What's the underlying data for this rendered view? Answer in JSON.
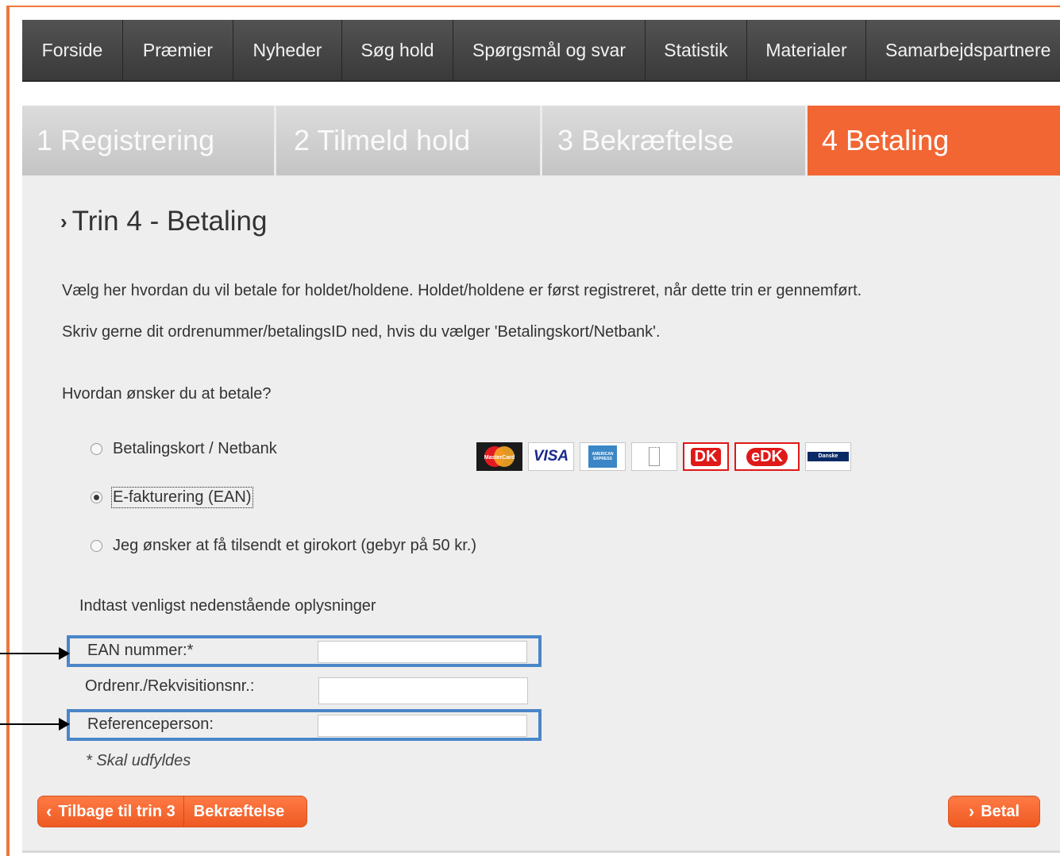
{
  "nav": {
    "items": [
      {
        "label": "Forside"
      },
      {
        "label": "Præmier"
      },
      {
        "label": "Nyheder"
      },
      {
        "label": "Søg hold"
      },
      {
        "label": "Spørgsmål og svar"
      },
      {
        "label": "Statistik"
      },
      {
        "label": "Materialer"
      },
      {
        "label": "Samarbejdspartnere"
      }
    ]
  },
  "steps": [
    {
      "label": "1 Registrering"
    },
    {
      "label": "2 Tilmeld hold"
    },
    {
      "label": "3 Bekræftelse"
    },
    {
      "label": "4 Betaling",
      "active": true
    }
  ],
  "page": {
    "title": "Trin 4 - Betaling",
    "intro1": "Vælg her hvordan du vil betale for holdet/holdene. Holdet/holdene er først registreret, når dette trin er gennemført.",
    "intro2": "Skriv gerne dit ordrenummer/betalingsID ned, hvis du vælger 'Betalingskort/Netbank'.",
    "question": "Hvordan ønsker du at betale?"
  },
  "payment_options": [
    {
      "label": "Betalingskort / Netbank",
      "checked": false
    },
    {
      "label": "E-fakturering (EAN)",
      "checked": true
    },
    {
      "label": "Jeg ønsker at få tilsendt et girokort (gebyr på 50 kr.)",
      "checked": false
    }
  ],
  "card_logos": {
    "mastercard": "MasterCard",
    "visa": "VISA",
    "amex": "AMERICAN EXPRESS",
    "jcb": "JCB",
    "dankort": "DK",
    "edankort": "eDK",
    "danske": "Danske"
  },
  "form": {
    "title": "Indtast venligst nedenstående oplysninger",
    "fields": [
      {
        "label": "EAN nummer:*",
        "value": ""
      },
      {
        "label": "Ordrenr./Rekvisitionsnr.:",
        "value": ""
      },
      {
        "label": "Referenceperson:",
        "value": ""
      }
    ],
    "required_note": "* Skal udfyldes"
  },
  "buttons": {
    "back_part1": "Tilbage til trin 3",
    "back_part2": "Bekræftelse",
    "pay": "Betal"
  },
  "colors": {
    "accent": "#f26633",
    "highlight": "#4a86c8",
    "nav_bg": "#444444"
  }
}
